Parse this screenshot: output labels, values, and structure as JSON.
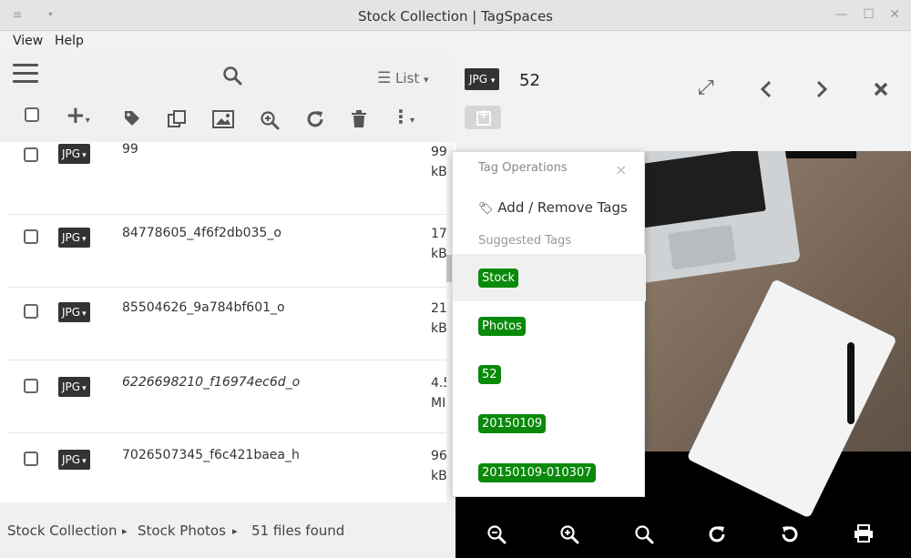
{
  "window": {
    "title": "Stock Collection | TagSpaces",
    "left_controls": "≡ •",
    "minimize": "—",
    "maximize": "☐",
    "close": "✕"
  },
  "menu": {
    "items": [
      "View",
      "Help"
    ]
  },
  "left_toolbar": {
    "list_label": "List",
    "list_caret": "▾"
  },
  "files": [
    {
      "type": "JPG",
      "name": "99",
      "size_lines": [
        "99",
        "kB"
      ]
    },
    {
      "type": "JPG",
      "name": "84778605_4f6f2db035_o",
      "size_lines": [
        "17",
        "kB"
      ]
    },
    {
      "type": "JPG",
      "name": "85504626_9a784bf601_o",
      "size_lines": [
        "21",
        "kB"
      ]
    },
    {
      "type": "JPG",
      "name": "6226698210_f16974ec6d_o",
      "size_lines": [
        "4.5",
        "MI"
      ]
    },
    {
      "type": "JPG",
      "name": "7026507345_f6c421baea_h",
      "size_lines": [
        "96",
        "kB"
      ]
    }
  ],
  "footer": {
    "crumb1": "Stock Collection",
    "crumb2": "Stock Photos",
    "separator": "▸",
    "status": "51 files found"
  },
  "viewer": {
    "type": "JPG",
    "title": "52"
  },
  "tag_popup": {
    "header": "Tag Operations",
    "close": "×",
    "action": "Add / Remove Tags",
    "suggested_label": "Suggested Tags",
    "tags": [
      "Stock",
      "Photos",
      "52",
      "20150109",
      "20150109-010307"
    ]
  },
  "icons": {
    "colors": {
      "tag_green": "#0a8a0a",
      "badge_dark": "#333333"
    }
  }
}
